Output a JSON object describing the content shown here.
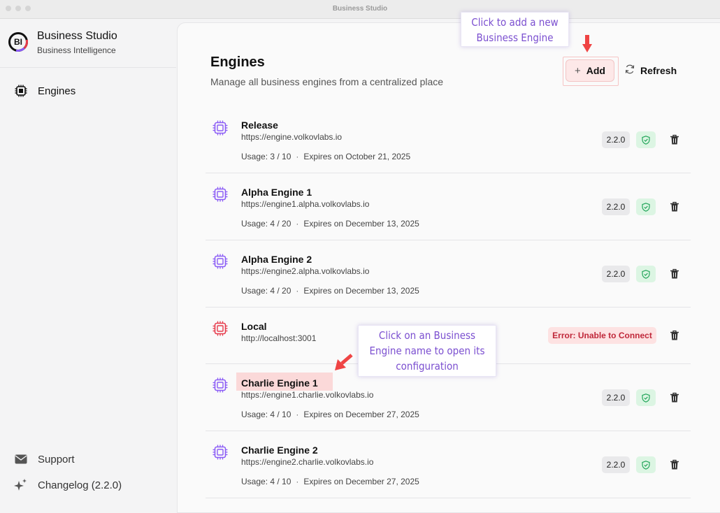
{
  "window": {
    "title": "Business Studio"
  },
  "sidebar": {
    "brand_logo": "BI",
    "brand_name": "Business Studio",
    "brand_sub": "Business Intelligence",
    "nav": [
      {
        "label": "Engines",
        "icon": "chip-icon"
      }
    ],
    "footer": [
      {
        "label": "Support",
        "icon": "mail-icon"
      },
      {
        "label": "Changelog (2.2.0)",
        "icon": "sparkles-icon"
      }
    ]
  },
  "main": {
    "title": "Engines",
    "subtitle": "Manage all business engines from a centralized place",
    "add_label": "Add",
    "refresh_label": "Refresh"
  },
  "engines": [
    {
      "name": "Release",
      "url": "https://engine.volkovlabs.io",
      "usage": "Usage: 3 / 10",
      "expires": "Expires on October 21, 2025",
      "version": "2.2.0",
      "status": "ok"
    },
    {
      "name": "Alpha Engine 1",
      "url": "https://engine1.alpha.volkovlabs.io",
      "usage": "Usage: 4 / 20",
      "expires": "Expires on December 13, 2025",
      "version": "2.2.0",
      "status": "ok"
    },
    {
      "name": "Alpha Engine 2",
      "url": "https://engine2.alpha.volkovlabs.io",
      "usage": "Usage: 4 / 20",
      "expires": "Expires on December 13, 2025",
      "version": "2.2.0",
      "status": "ok"
    },
    {
      "name": "Local",
      "url": "http://localhost:3001",
      "error": "Error: Unable to Connect",
      "status": "error"
    },
    {
      "name": "Charlie Engine 1",
      "url": "https://engine1.charlie.volkovlabs.io",
      "usage": "Usage: 4 / 10",
      "expires": "Expires on December 27, 2025",
      "version": "2.2.0",
      "status": "ok"
    },
    {
      "name": "Charlie Engine 2",
      "url": "https://engine2.charlie.volkovlabs.io",
      "usage": "Usage: 4 / 10",
      "expires": "Expires on December 27, 2025",
      "version": "2.2.0",
      "status": "ok"
    }
  ],
  "annotations": {
    "add_callout": [
      "Click to add a new",
      "Business Engine"
    ],
    "name_callout": [
      "Click on an Business",
      "Engine name to open its",
      "configuration"
    ]
  },
  "colors": {
    "accent": "#8b5cf6",
    "error": "#e63a4b",
    "success": "#22a559",
    "callout": "#7b4fd0",
    "arrow": "#ef4444"
  }
}
